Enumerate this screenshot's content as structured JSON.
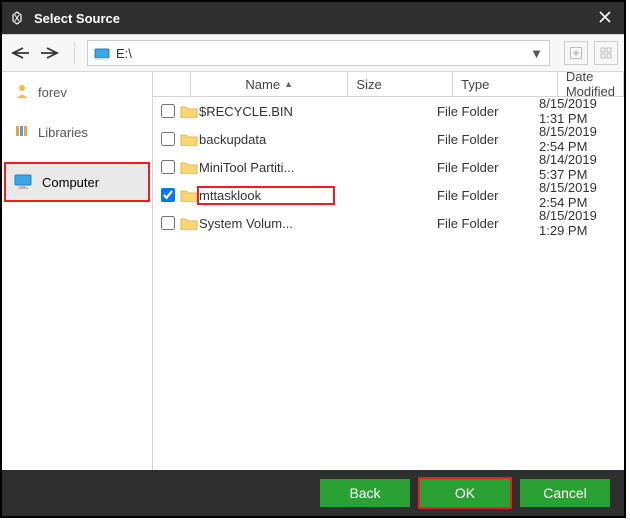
{
  "window": {
    "title": "Select Source"
  },
  "address": {
    "path": "E:\\"
  },
  "sidebar": {
    "items": [
      {
        "label": "forev",
        "icon": "user-icon"
      },
      {
        "label": "Libraries",
        "icon": "libraries-icon"
      },
      {
        "label": "Computer",
        "icon": "monitor-icon"
      }
    ]
  },
  "columns": {
    "name": "Name",
    "size": "Size",
    "type": "Type",
    "date": "Date Modified"
  },
  "rows": [
    {
      "checked": false,
      "name": "$RECYCLE.BIN",
      "size": "",
      "type": "File Folder",
      "date": "8/15/2019 1:31 PM",
      "highlight": false
    },
    {
      "checked": false,
      "name": "backupdata",
      "size": "",
      "type": "File Folder",
      "date": "8/15/2019 2:54 PM",
      "highlight": false
    },
    {
      "checked": false,
      "name": "MiniTool Partiti...",
      "size": "",
      "type": "File Folder",
      "date": "8/14/2019 5:37 PM",
      "highlight": false
    },
    {
      "checked": true,
      "name": "mttasklook",
      "size": "",
      "type": "File Folder",
      "date": "8/15/2019 2:54 PM",
      "highlight": true
    },
    {
      "checked": false,
      "name": "System Volum...",
      "size": "",
      "type": "File Folder",
      "date": "8/15/2019 1:29 PM",
      "highlight": false
    }
  ],
  "footer": {
    "back": "Back",
    "ok": "OK",
    "cancel": "Cancel"
  }
}
